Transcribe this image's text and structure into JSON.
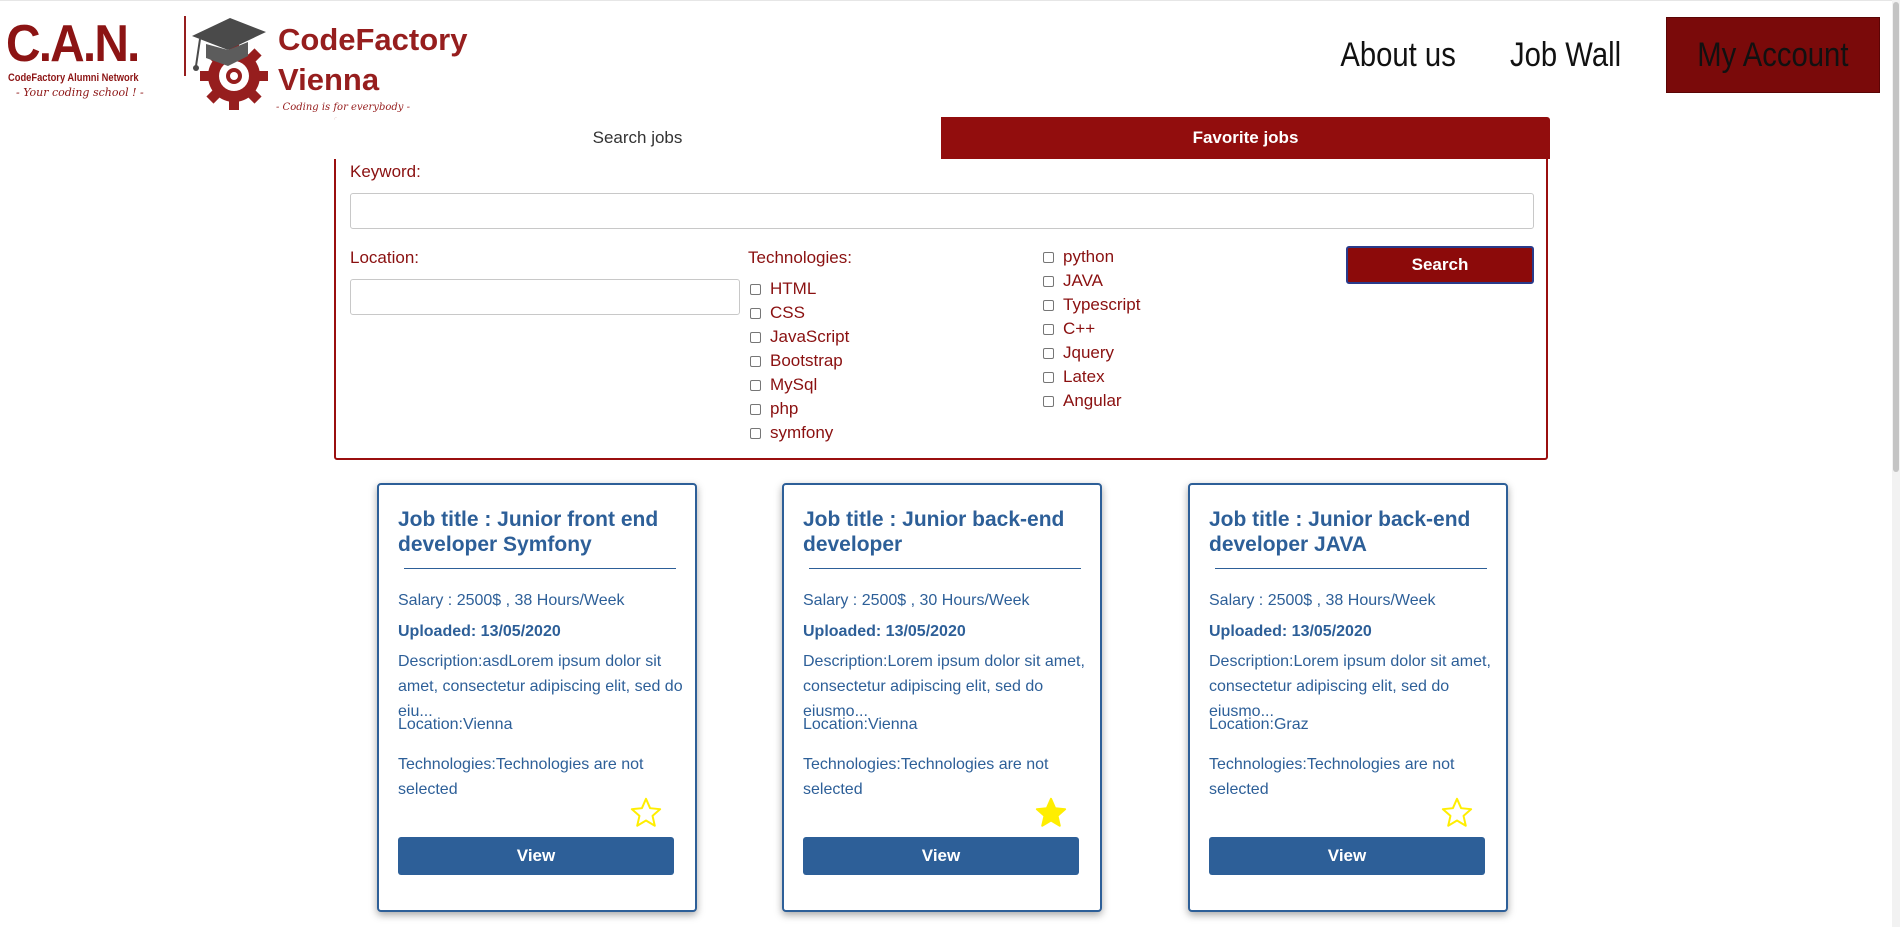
{
  "header": {
    "can_logo": {
      "title": "C.A.N.",
      "subtitle": "CodeFactory Alumni Network",
      "tagline": "- Your coding school ! -"
    },
    "cf_logo": {
      "name_line1": "CodeFactory",
      "name_line2": "Vienna",
      "tagline": "- Coding is for everybody -"
    },
    "nav": [
      {
        "label": "About us",
        "active": false
      },
      {
        "label": "Job Wall",
        "active": false
      },
      {
        "label": "My Account",
        "active": true
      }
    ]
  },
  "search_panel": {
    "tabs": {
      "search": "Search jobs",
      "favorites": "Favorite jobs"
    },
    "keyword_label": "Keyword:",
    "location_label": "Location:",
    "technologies_label": "Technologies:",
    "technologies_col1": [
      "HTML",
      "CSS",
      "JavaScript",
      "Bootstrap",
      "MySql",
      "php",
      "symfony"
    ],
    "technologies_col2": [
      "python",
      "JAVA",
      "Typescript",
      "C++",
      "Jquery",
      "Latex",
      "Angular"
    ],
    "search_button": "Search"
  },
  "jobs": [
    {
      "title": "Job title : Junior front end developer Symfony",
      "salary": "Salary : 2500$ , 38 Hours/Week",
      "uploaded": "Uploaded: 13/05/2020",
      "description": "Description:asdLorem ipsum dolor sit amet, consectetur adipiscing elit, sed do eiu...",
      "location": "Location:Vienna",
      "technologies": "Technologies:Technologies are not selected",
      "favorite": false,
      "view_label": "View"
    },
    {
      "title": "Job title : Junior back-end developer",
      "salary": "Salary : 2500$ , 30 Hours/Week",
      "uploaded": "Uploaded: 13/05/2020",
      "description": "Description:Lorem ipsum dolor sit amet, consectetur adipiscing elit, sed do eiusmo...",
      "location": "Location:Vienna",
      "technologies": "Technologies:Technologies are not selected",
      "favorite": true,
      "view_label": "View"
    },
    {
      "title": "Job title : Junior back-end developer JAVA",
      "salary": "Salary : 2500$ , 38 Hours/Week",
      "uploaded": "Uploaded: 13/05/2020",
      "description": "Description:Lorem ipsum dolor sit amet, consectetur adipiscing elit, sed do eiusmo...",
      "location": "Location:Graz",
      "technologies": "Technologies:Technologies are not selected",
      "favorite": false,
      "view_label": "View"
    }
  ],
  "colors": {
    "brand_red": "#920d0d",
    "card_blue": "#2d5f98",
    "star_yellow": "#ffee00"
  }
}
